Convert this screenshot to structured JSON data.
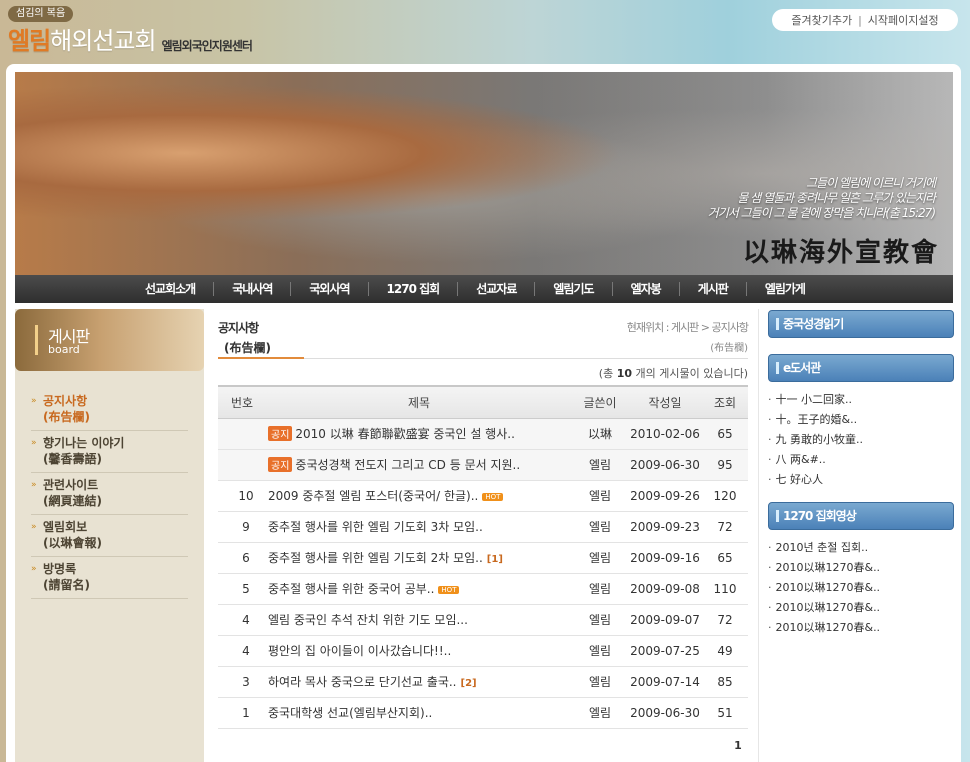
{
  "header": {
    "tagline": "섬김의 복음",
    "logo_accent": "엘림",
    "logo_main": "해외선교회",
    "logo_sub": "엘림외국인지원센터",
    "links": [
      "즐겨찾기추가",
      "시작페이지설정"
    ],
    "links_separator": "|"
  },
  "banner": {
    "quote_lines": [
      "그들이 엘림에 이르니 거기에",
      "물 샘 열둘과 종려나무 일흔 그루가 있는지라",
      "거기서 그들이 그 물 곁에 장막을 치니라(출 15:27)"
    ],
    "calligraphy": "以琳海外宣教會"
  },
  "nav": {
    "items": [
      "선교회소개",
      "국내사역",
      "국외사역",
      "1270 집회",
      "선교자료",
      "엘림기도",
      "엘자봉",
      "게시판",
      "엘림가게"
    ]
  },
  "left": {
    "title": "게시판",
    "subtitle": "board",
    "menu": [
      {
        "label": "공지사항",
        "sub": "(布告欄)"
      },
      {
        "label": "향기나는 이야기",
        "sub": "(馨香壽語)"
      },
      {
        "label": "관련사이트",
        "sub": "(網頁連結)"
      },
      {
        "label": "엘림회보",
        "sub": "(以琳會報)"
      },
      {
        "label": "방명록",
        "sub": "(請留名)"
      }
    ]
  },
  "board": {
    "title": "공지사항",
    "title_sub": "(布告欄)",
    "location": "현재위치 : 게시판 > 공지사항",
    "location_sub": "(布告欄)",
    "count_prefix": "(총",
    "count_value": "10",
    "count_suffix": "개의 게시물이 있습니다)",
    "columns": [
      "번호",
      "제목",
      "글쓴이",
      "작성일",
      "조회"
    ],
    "notice_label": "공지",
    "hot_label": "HOT",
    "rows": [
      {
        "num": "",
        "notice": true,
        "title": "2010 以琳 春節聯歡盛宴 중국인 설 행사..",
        "author": "以琳",
        "date": "2010-02-06",
        "views": "65"
      },
      {
        "num": "",
        "notice": true,
        "title": "중국성경책 전도지 그리고 CD 등 문서 지원..",
        "author": "엘림",
        "date": "2009-06-30",
        "views": "95"
      },
      {
        "num": "10",
        "title": "2009 중추절 엘림 포스터(중국어/ 한글)..",
        "hot": true,
        "author": "엘림",
        "date": "2009-09-26",
        "views": "120"
      },
      {
        "num": "9",
        "title": "중추절 행사를 위한 엘림 기도회 3차 모임..",
        "author": "엘림",
        "date": "2009-09-23",
        "views": "72"
      },
      {
        "num": "6",
        "title": "중추절 행사를 위한 엘림 기도회 2차 모임..",
        "comments": "[1]",
        "author": "엘림",
        "date": "2009-09-16",
        "views": "65"
      },
      {
        "num": "5",
        "title": "중추절 행사를 위한 중국어 공부..",
        "hot": true,
        "author": "엘림",
        "date": "2009-09-08",
        "views": "110"
      },
      {
        "num": "4",
        "title": "엘림 중국인 추석 잔치 위한 기도 모임...",
        "author": "엘림",
        "date": "2009-09-07",
        "views": "72"
      },
      {
        "num": "4",
        "title": "평안의 집 아이들이 이사갔습니다!!..",
        "author": "엘림",
        "date": "2009-07-25",
        "views": "49"
      },
      {
        "num": "3",
        "title": "하여라 목사 중국으로 단기선교 출국..",
        "comments": "[2]",
        "author": "엘림",
        "date": "2009-07-14",
        "views": "85"
      },
      {
        "num": "1",
        "title": "중국대학생 선교(엘림부산지회)..",
        "author": "엘림",
        "date": "2009-06-30",
        "views": "51"
      }
    ],
    "page": "1"
  },
  "right": {
    "bible_title": "중국성경읽기",
    "library_title": "e도서관",
    "library_items": [
      "十一 小二回家..",
      "十。王子的婚&..",
      "九 勇敢的小牧童..",
      "八 两&#..",
      "七 好心人"
    ],
    "video_title": "1270 집회영상",
    "video_items": [
      "2010년 춘절 집회..",
      "2010以琳1270春&..",
      "2010以琳1270春&..",
      "2010以琳1270春&..",
      "2010以琳1270春&.."
    ]
  }
}
